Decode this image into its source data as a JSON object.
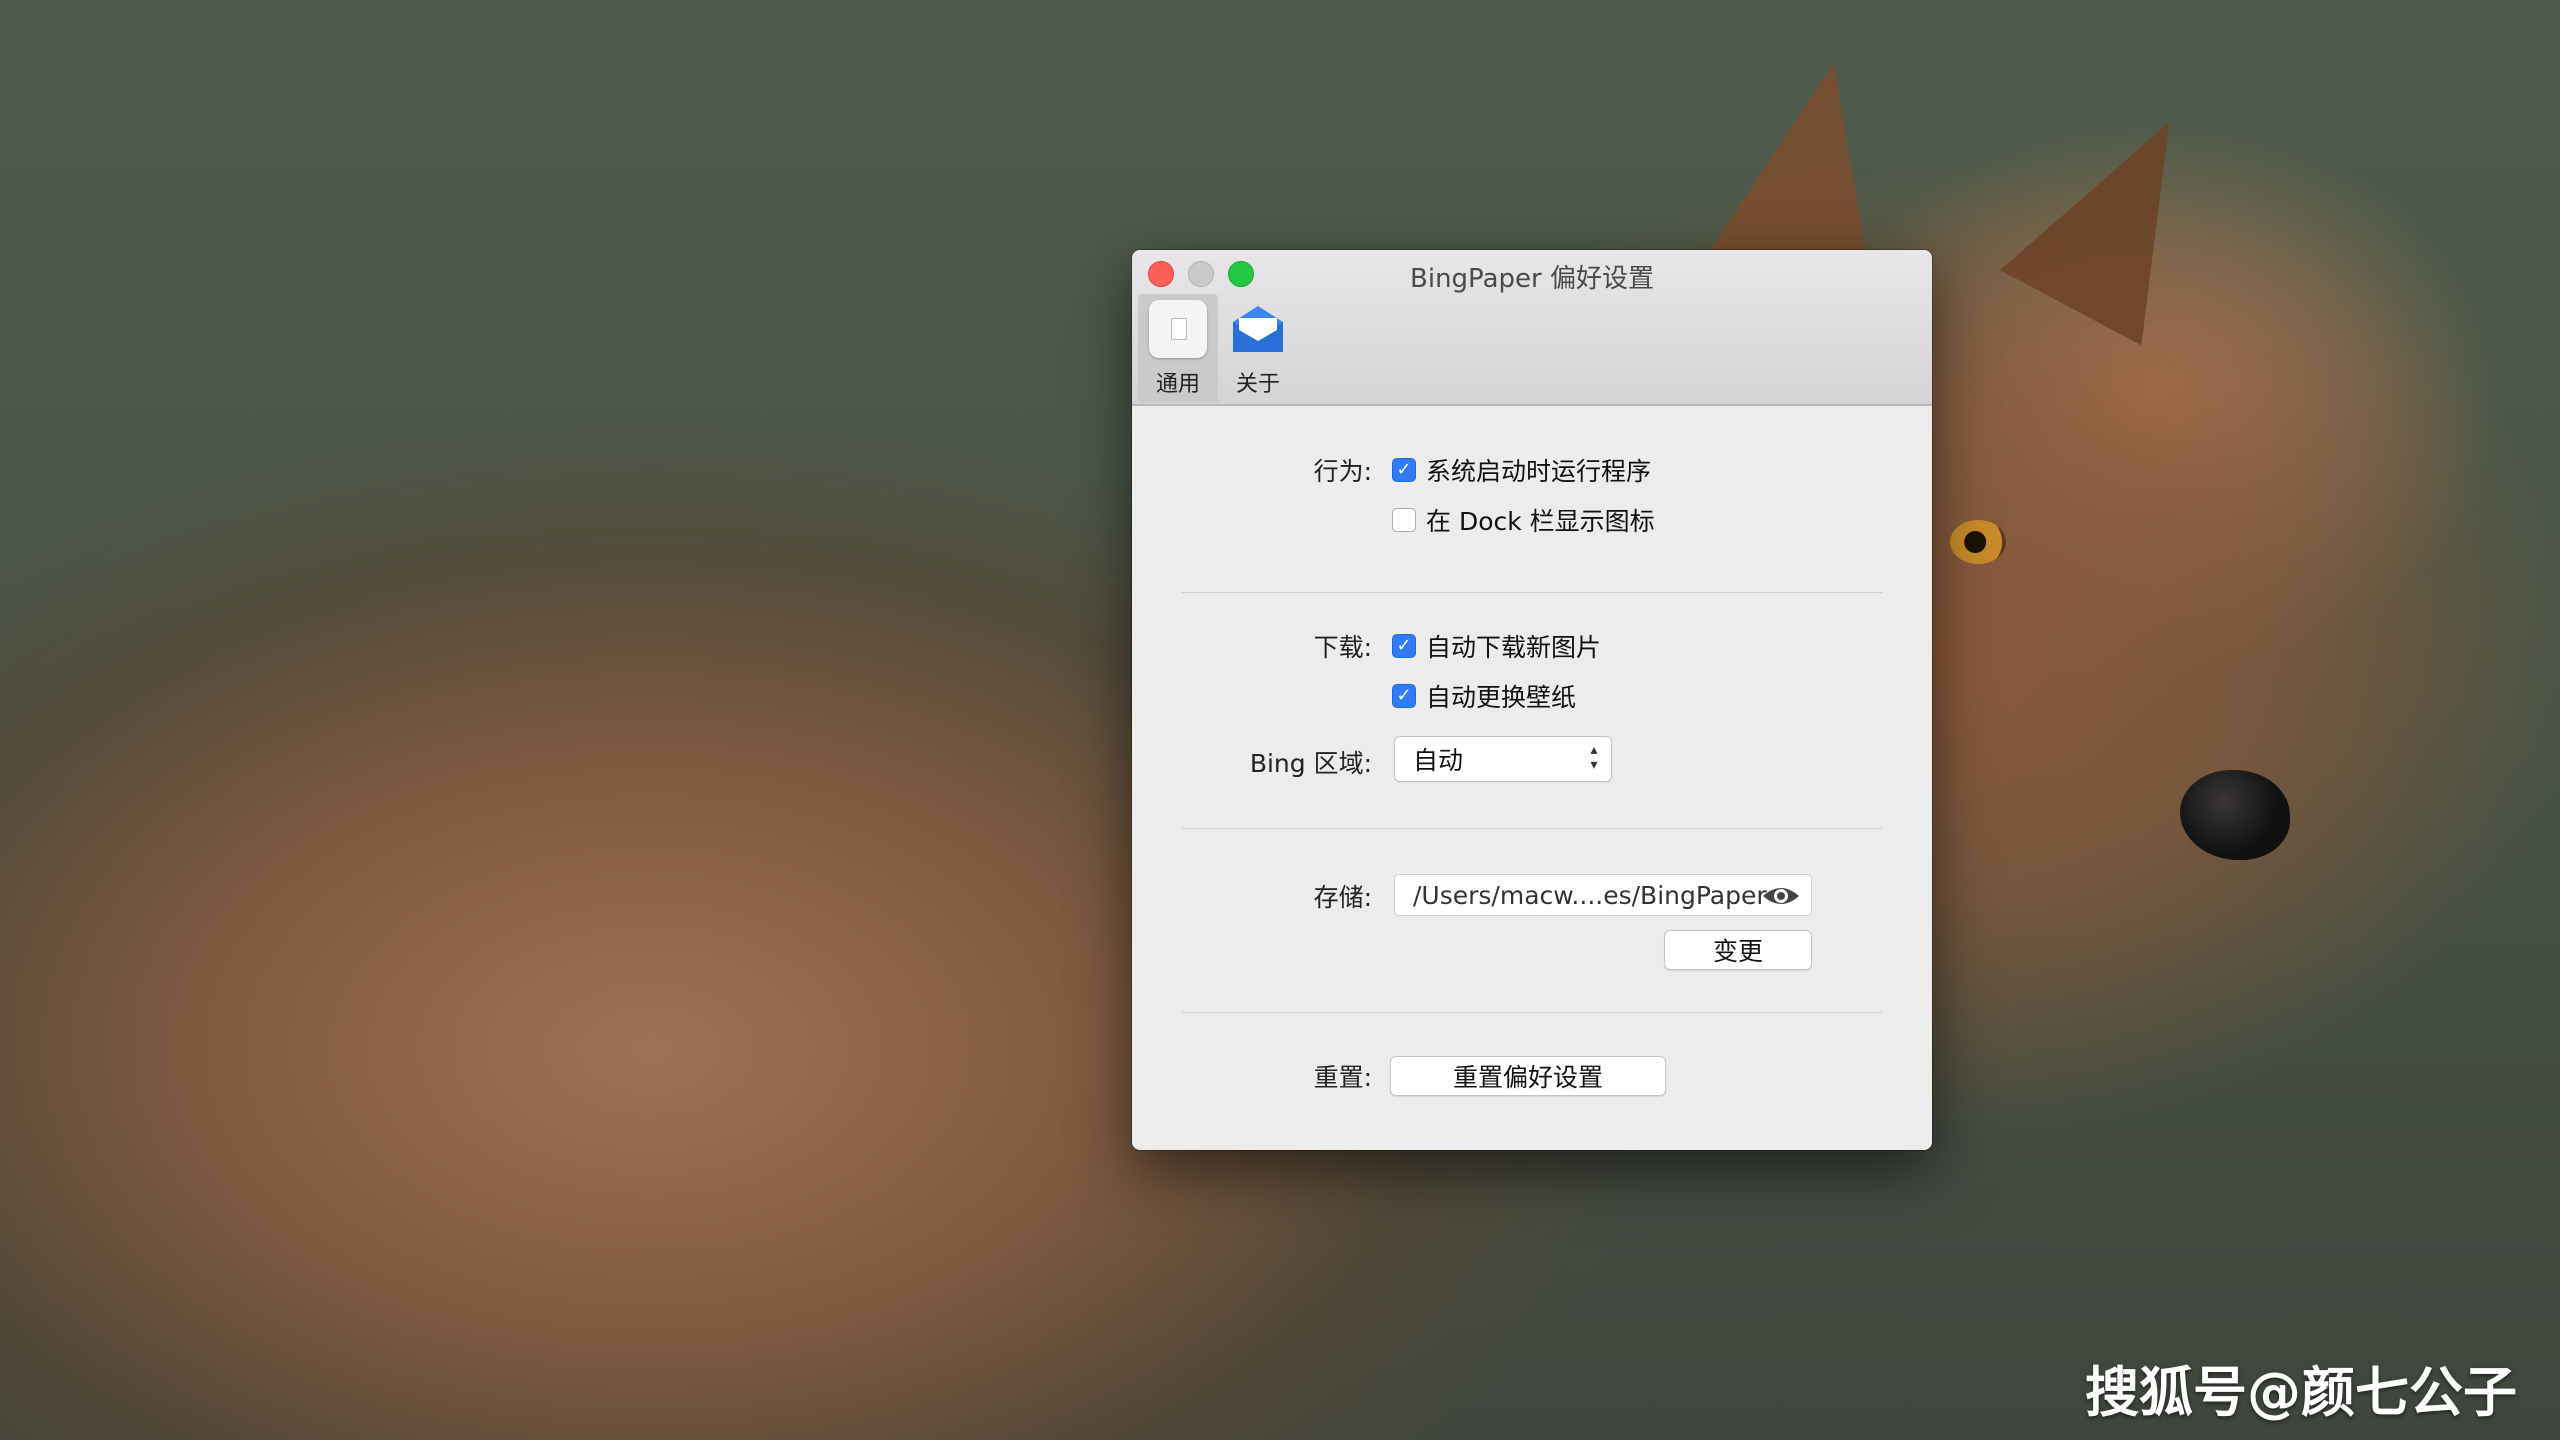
{
  "window": {
    "title": "BingPaper 偏好设置"
  },
  "toolbar": {
    "tabs": [
      {
        "label": "通用",
        "icon": "general-switch-icon",
        "selected": true
      },
      {
        "label": "关于",
        "icon": "envelope-icon",
        "selected": false
      }
    ]
  },
  "behavior": {
    "label": "行为:",
    "launch_at_login": {
      "text": "系统启动时运行程序",
      "checked": true
    },
    "show_in_dock": {
      "text": "在 Dock 栏显示图标",
      "checked": false
    }
  },
  "download": {
    "label": "下载:",
    "auto_download": {
      "text": "自动下载新图片",
      "checked": true
    },
    "auto_change": {
      "text": "自动更换壁纸",
      "checked": true
    },
    "region_label": "Bing 区域:",
    "region_value": "自动"
  },
  "storage": {
    "label": "存储:",
    "path": "/Users/macw....es/BingPaper",
    "change_button": "变更"
  },
  "reset": {
    "label": "重置:",
    "button": "重置偏好设置"
  },
  "watermark": "搜狐号@颜七公子",
  "colors": {
    "checkbox_accent": "#2f7cf6",
    "close": "#fd5f57",
    "zoom": "#27c840"
  }
}
